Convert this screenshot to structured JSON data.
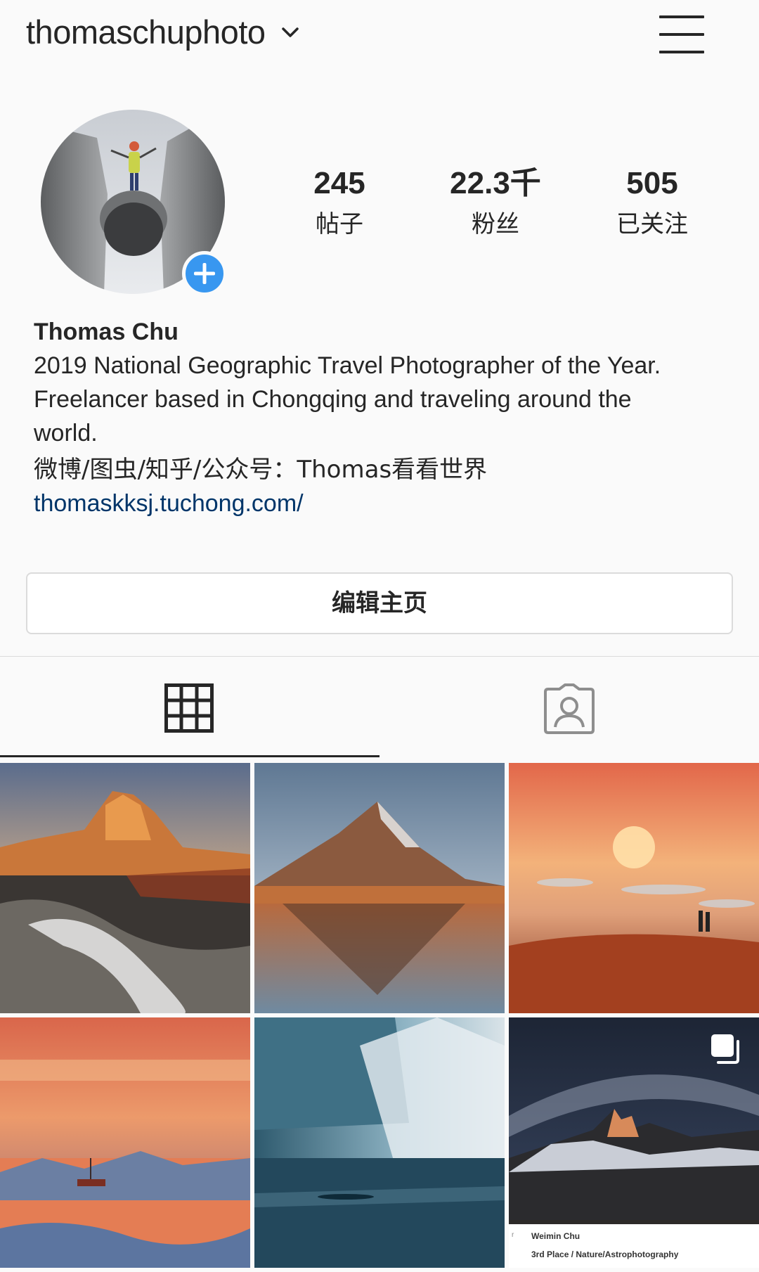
{
  "header": {
    "username": "thomaschuphoto"
  },
  "stats": [
    {
      "value": "245",
      "label": "帖子"
    },
    {
      "value": "22.3千",
      "label": "粉丝"
    },
    {
      "value": "505",
      "label": "已关注"
    }
  ],
  "bio": {
    "name": "Thomas Chu",
    "line1": "2019 National Geographic Travel Photographer of the Year.",
    "line2": "Freelancer based in Chongqing and traveling around the",
    "line3": "world.",
    "line4": "微博/图虫/知乎/公众号：Thomas看看世界",
    "link": "thomaskksj.tuchong.com/"
  },
  "edit_profile_label": "编辑主页",
  "tabs": [
    {
      "icon": "grid-icon",
      "active": true
    },
    {
      "icon": "tagged-person-icon",
      "active": false
    }
  ],
  "grid_caption": {
    "tick": "r",
    "author": "Weimin Chu",
    "award": "3rd Place / Nature/Astrophotography"
  },
  "colors": {
    "accent": "#3897f0",
    "link": "#003569",
    "text": "#262626",
    "border": "#dbdbdb"
  }
}
